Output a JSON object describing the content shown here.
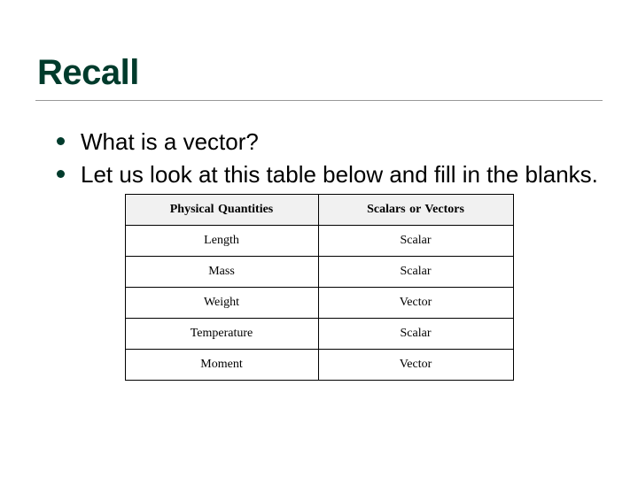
{
  "title": "Recall",
  "bullets": [
    "What is a vector?",
    "Let us look at this table below and fill in the blanks."
  ],
  "table": {
    "headers": [
      "Physical Quantities",
      "Scalars or Vectors"
    ],
    "rows": [
      [
        "Length",
        "Scalar"
      ],
      [
        "Mass",
        "Scalar"
      ],
      [
        "Weight",
        "Vector"
      ],
      [
        "Temperature",
        "Scalar"
      ],
      [
        "Moment",
        "Vector"
      ]
    ]
  }
}
